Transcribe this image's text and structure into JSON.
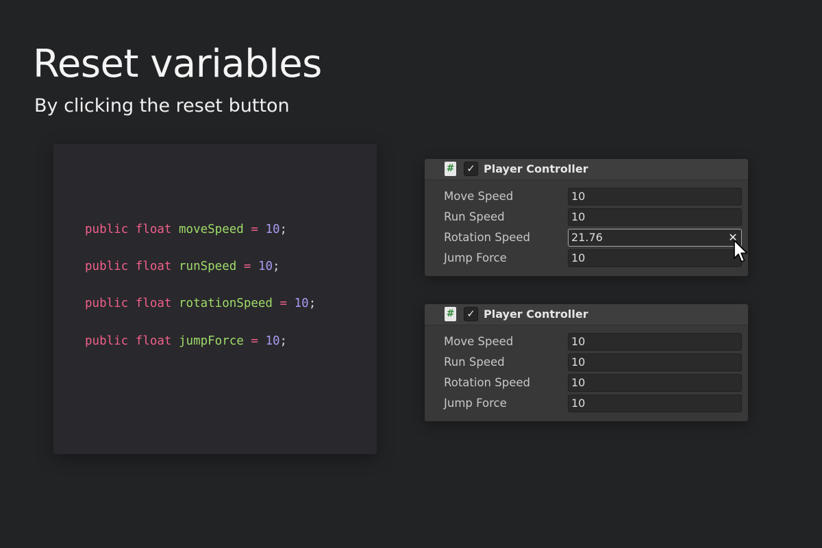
{
  "title": "Reset variables",
  "subtitle": "By clicking the reset button",
  "code": {
    "lines": [
      {
        "kw1": "public",
        "kw2": "float",
        "name": "moveSpeed",
        "op": "=",
        "value": "10",
        "end": ";"
      },
      {
        "kw1": "public",
        "kw2": "float",
        "name": "runSpeed",
        "op": "=",
        "value": "10",
        "end": ";"
      },
      {
        "kw1": "public",
        "kw2": "float",
        "name": "rotationSpeed",
        "op": "=",
        "value": "10",
        "end": ";"
      },
      {
        "kw1": "public",
        "kw2": "float",
        "name": "jumpForce",
        "op": "=",
        "value": "10",
        "end": ";"
      }
    ]
  },
  "inspectors": [
    {
      "component_title": "Player Controller",
      "script_icon_glyph": "#",
      "enabled_glyph": "✓",
      "fields": [
        {
          "label": "Move Speed",
          "value": "10"
        },
        {
          "label": "Run Speed",
          "value": "10"
        },
        {
          "label": "Rotation Speed",
          "value": "21.76",
          "reset_glyph": "✕"
        },
        {
          "label": "Jump Force",
          "value": "10"
        }
      ]
    },
    {
      "component_title": "Player Controller",
      "script_icon_glyph": "#",
      "enabled_glyph": "✓",
      "fields": [
        {
          "label": "Move Speed",
          "value": "10"
        },
        {
          "label": "Run Speed",
          "value": "10"
        },
        {
          "label": "Rotation Speed",
          "value": "10"
        },
        {
          "label": "Jump Force",
          "value": "10"
        }
      ]
    }
  ],
  "icons": {
    "script": "csharp-script-icon",
    "toggle": "checkbox-icon",
    "reset": "close-icon",
    "cursor": "mouse-pointer-icon"
  },
  "colors": {
    "background": "#222325",
    "code_keyword": "#f0608a",
    "code_identifier": "#9fdc6a",
    "code_number": "#a99af2",
    "panel": "#383838"
  }
}
